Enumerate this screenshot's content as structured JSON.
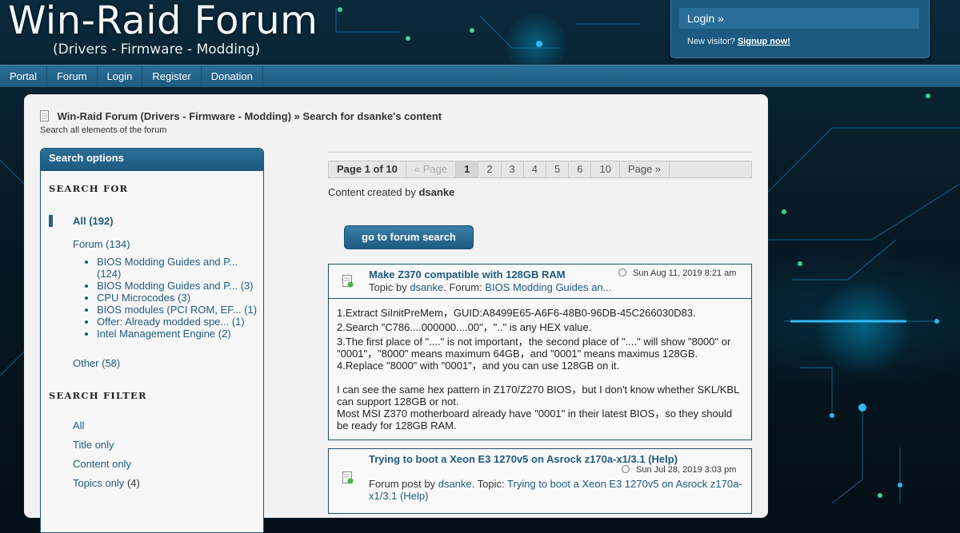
{
  "header": {
    "title": "Win-Raid Forum",
    "subtitle": "(Drivers - Firmware - Modding)"
  },
  "login": {
    "label": "Login »",
    "new_visitor": "New visitor?",
    "signup": "Signup now!"
  },
  "nav": {
    "items": [
      "Portal",
      "Forum",
      "Login",
      "Register",
      "Donation"
    ]
  },
  "breadcrumb": {
    "root": "Win-Raid Forum (Drivers - Firmware - Modding)",
    "separator": "»",
    "current": "Search for dsanke's content",
    "description": "Search all elements of the forum"
  },
  "sidebar": {
    "header": "Search options",
    "search_for_title": "SEARCH FOR",
    "all": "All (192)",
    "forum": "Forum (134)",
    "subforums": [
      "BIOS Modding Guides and P... (124)",
      "BIOS Modding Guides and P... (3)",
      "CPU Microcodes (3)",
      "BIOS modules (PCI ROM, EF... (1)",
      "Offer: Already modded spe... (1)",
      "Intel Management Engine (2)"
    ],
    "other": "Other (58)",
    "search_filter_title": "SEARCH FILTER",
    "filters": {
      "all": "All",
      "title_only": "Title only",
      "content_only": "Content only",
      "topics_only": "Topics only",
      "topics_count": "(4)"
    }
  },
  "pagination": {
    "label": "Page 1 of 10",
    "prev": "« Page",
    "pages": [
      "1",
      "2",
      "3",
      "4",
      "5",
      "6",
      "10"
    ],
    "current": "1",
    "next": "Page »"
  },
  "content_by": {
    "prefix": "Content created by",
    "user": "dsanke"
  },
  "search_button": "go to forum search",
  "results": [
    {
      "title": "Make Z370 compatible with 128GB RAM",
      "date": "Sun Aug 11, 2019 8:21 am",
      "meta_prefix": "Topic by",
      "author": "dsanke",
      "meta_mid": ". Forum:",
      "forum": "BIOS Modding Guides an...",
      "body": [
        "1.Extract SiInitPreMem，GUID:A8499E65-A6F6-48B0-96DB-45C266030D83.",
        "2.Search \"C786....000000....00\"，\"..\" is any HEX value.",
        "3.The first place of \"....\" is not important，the second place of \"....\" will show \"8000\" or \"0001\"，\"8000\" means maximum 64GB，and \"0001\" means maximus 128GB.",
        "4.Replace \"8000\" with \"0001\"，and you can use 128GB on it.",
        "",
        "I can see the same hex pattern in Z170/Z270 BIOS，but I don't know whether SKL/KBL can support 128GB or not.",
        "Most MSI Z370 motherboard already have \"0001\" in their latest BIOS，so they should be ready for 128GB RAM."
      ]
    },
    {
      "title": "Trying to boot a Xeon E3 1270v5 on Asrock z170a-x1/3.1 (Help)",
      "date": "Sun Jul 28, 2019 3:03 pm",
      "meta_prefix": "Forum post by",
      "author": "dsanke",
      "meta_mid": ". Topic:",
      "topic": "Trying to boot a Xeon E3 1270v5 on Asrock z170a-x1/3.1 (Help)"
    }
  ],
  "colors": {
    "accent": "#1d5a80",
    "link": "#1f5a7e",
    "panel": "#f2f2f2"
  }
}
